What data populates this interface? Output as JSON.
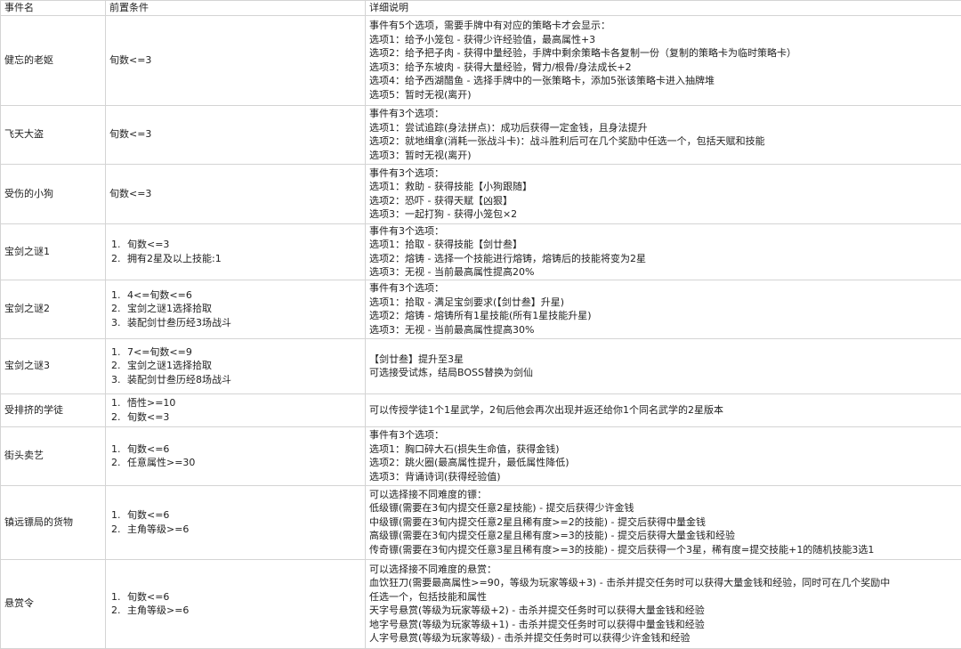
{
  "headers": [
    "事件名",
    "前置条件",
    "详细说明"
  ],
  "rows": [
    {
      "name": "健忘的老妪",
      "conditions": [
        "旬数<=3"
      ],
      "numbered": false,
      "desc": [
        "事件有5个选项，需要手牌中有对应的策略卡才会显示：",
        "选项1：给予小笼包 - 获得少许经验值，最高属性+3",
        "选项2：给予把子肉 - 获得中量经验，手牌中剩余策略卡各复制一份（复制的策略卡为临时策略卡）",
        "选项3：给予东坡肉 - 获得大量经验，臂力/根骨/身法成长+2",
        "选项4：给予西湖醋鱼 - 选择手牌中的一张策略卡，添加5张该策略卡进入抽牌堆",
        "选项5：暂时无视(离开)"
      ]
    },
    {
      "name": "飞天大盗",
      "conditions": [
        "旬数<=3"
      ],
      "numbered": false,
      "desc": [
        "事件有3个选项：",
        "选项1：尝试追踪(身法拼点)：成功后获得一定金钱，且身法提升",
        "选项2：就地缉拿(消耗一张战斗卡)：战斗胜利后可在几个奖励中任选一个，包括天赋和技能",
        "选项3：暂时无视(离开)"
      ]
    },
    {
      "name": "受伤的小狗",
      "conditions": [
        "旬数<=3"
      ],
      "numbered": false,
      "desc": [
        "事件有3个选项：",
        "选项1：救助 - 获得技能【小狗跟随】",
        "选项2：恐吓 - 获得天赋【凶狠】",
        "选项3：一起打狗 - 获得小笼包×2"
      ]
    },
    {
      "name": "宝剑之谜1",
      "conditions": [
        "旬数<=3",
        "拥有2星及以上技能:1"
      ],
      "numbered": true,
      "desc": [
        "事件有3个选项：",
        "选项1：拾取 - 获得技能【剑廿叁】",
        "选项2：熔铸 - 选择一个技能进行熔铸，熔铸后的技能将变为2星",
        "选项3：无视 - 当前最高属性提高20%"
      ]
    },
    {
      "name": "宝剑之谜2",
      "conditions": [
        "4<=旬数<=6",
        "宝剑之谜1选择拾取",
        "装配剑廿叁历经3场战斗"
      ],
      "numbered": true,
      "desc": [
        "事件有3个选项：",
        "选项1：拾取 - 满足宝剑要求(【剑廿叁】升星)",
        "选项2：熔铸 - 熔铸所有1星技能(所有1星技能升星)",
        "选项3：无视 - 当前最高属性提高30%"
      ]
    },
    {
      "name": "宝剑之谜3",
      "conditions": [
        "7<=旬数<=9",
        "宝剑之谜1选择拾取",
        "装配剑廿叁历经8场战斗"
      ],
      "numbered": true,
      "desc": [
        "【剑廿叁】提升至3星",
        "可选接受试炼，结局BOSS替换为剑仙"
      ]
    },
    {
      "name": "受排挤的学徒",
      "conditions": [
        "悟性>=10",
        "旬数<=3"
      ],
      "numbered": true,
      "desc": [
        "可以传授学徒1个1星武学，2旬后他会再次出现并返还给你1个同名武学的2星版本"
      ]
    },
    {
      "name": "街头卖艺",
      "conditions": [
        "旬数<=6",
        "任意属性>=30"
      ],
      "numbered": true,
      "desc": [
        "事件有3个选项：",
        "选项1：胸口碎大石(损失生命值，获得金钱)",
        "选项2：跳火圈(最高属性提升，最低属性降低)",
        "选项3：背诵诗词(获得经验值)"
      ]
    },
    {
      "name": "镇远镖局的货物",
      "conditions": [
        "旬数<=6",
        "主角等级>=6"
      ],
      "numbered": true,
      "desc": [
        "可以选择接不同难度的镖：",
        "低级镖(需要在3旬内提交任意2星技能) - 提交后获得少许金钱",
        "中级镖(需要在3旬内提交任意2星且稀有度>=2的技能) - 提交后获得中量金钱",
        "高级镖(需要在3旬内提交任意2星且稀有度>=3的技能) - 提交后获得大量金钱和经验",
        "传奇镖(需要在3旬内提交任意3星且稀有度>=3的技能) - 提交后获得一个3星，稀有度=提交技能+1的随机技能3选1"
      ]
    },
    {
      "name": "悬赏令",
      "conditions": [
        "旬数<=6",
        "主角等级>=6"
      ],
      "numbered": true,
      "desc": [
        "可以选择接不同难度的悬赏：",
        "血饮狂刀(需要最高属性>=90，等级为玩家等级+3) - 击杀并提交任务时可以获得大量金钱和经验，同时可在几个奖励中",
        "任选一个，包括技能和属性",
        "天字号悬赏(等级为玩家等级+2)  - 击杀并提交任务时可以获得大量金钱和经验",
        "地字号悬赏(等级为玩家等级+1)  - 击杀并提交任务时可以获得中量金钱和经验",
        "人字号悬赏(等级为玩家等级)  - 击杀并提交任务时可以获得少许金钱和经验"
      ]
    }
  ]
}
